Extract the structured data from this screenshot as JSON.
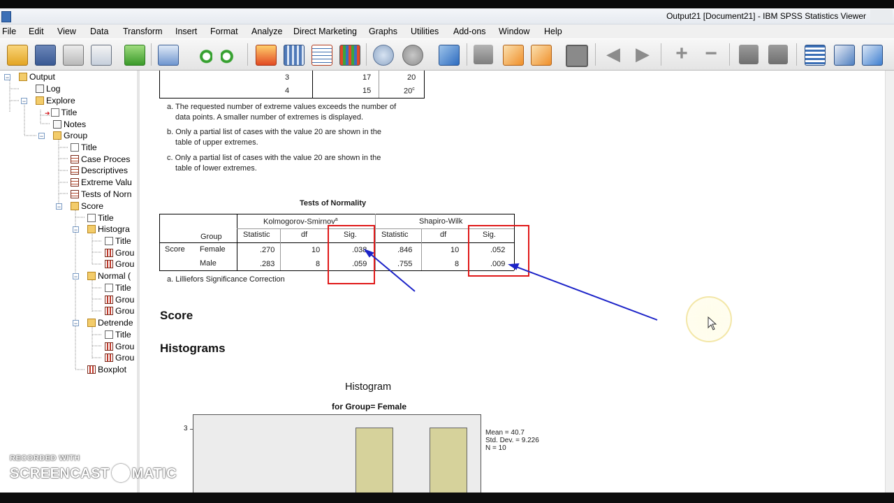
{
  "window": {
    "title": "Output21 [Document21] - IBM SPSS Statistics Viewer"
  },
  "menu": [
    "File",
    "Edit",
    "View",
    "Data",
    "Transform",
    "Insert",
    "Format",
    "Analyze",
    "Direct Marketing",
    "Graphs",
    "Utilities",
    "Add-ons",
    "Window",
    "Help"
  ],
  "toolbar_icons": [
    "open-icon",
    "save-icon",
    "print-icon",
    "print-preview-icon",
    "export-icon",
    "recall-dialog-icon",
    "undo-icon",
    "redo-icon",
    "goto-case-icon",
    "goto-variable-icon",
    "insert-case-icon",
    "variables-icon",
    "use-sets-icon",
    "show-all-variables-icon",
    "designate-window-icon",
    "promote-icon",
    "insert-heading-icon",
    "insert-title-icon",
    "insert-text-icon",
    "insert-output-icon",
    "back-icon",
    "forward-icon",
    "expand-icon",
    "collapse-icon",
    "show-icon",
    "hide-icon",
    "select-output-icon",
    "outline-icon",
    "export-output-icon"
  ],
  "tree": {
    "output": "Output",
    "log": "Log",
    "explore": "Explore",
    "title1": "Title",
    "notes": "Notes",
    "group": "Group",
    "g_title": "Title",
    "case_proc": "Case Proces",
    "descriptives": "Descriptives",
    "extreme": "Extreme Valu",
    "tests_norm": "Tests of Norn",
    "score": "Score",
    "s_title": "Title",
    "histogram": "Histogra",
    "h_title": "Title",
    "h_grou1": "Grou",
    "h_grou2": "Grou",
    "normal": "Normal (",
    "n_title": "Title",
    "n_grou1": "Grou",
    "n_grou2": "Grou",
    "detrended": "Detrende",
    "d_title": "Title",
    "d_grou1": "Grou",
    "d_grou2": "Grou",
    "boxplot": "Boxplot"
  },
  "extreme_table": {
    "rows": [
      {
        "case": "3",
        "number": "17",
        "value": "20"
      },
      {
        "case": "4",
        "number": "15",
        "value": "20",
        "sup": "c"
      }
    ],
    "footnotes": {
      "a1": "a. The requested number of extreme values exceeds the number of",
      "a2": "data points. A smaller number of extremes is displayed.",
      "b1": "b. Only a partial list of cases with the value 20 are shown in the",
      "b2": "table of upper extremes.",
      "c1": "c. Only a partial list of cases with the value 20 are shown in the",
      "c2": "table of lower extremes."
    }
  },
  "normality": {
    "title": "Tests of Normality",
    "ks_header": "Kolmogorov-Smirnov",
    "ks_sup": "a",
    "sw_header": "Shapiro-Wilk",
    "group_header": "Group",
    "col_statistic": "Statistic",
    "col_df": "df",
    "col_sig": "Sig.",
    "row_label": "Score",
    "rows": [
      {
        "group": "Female",
        "ks_stat": ".270",
        "ks_df": "10",
        "ks_sig": ".038",
        "sw_stat": ".846",
        "sw_df": "10",
        "sw_sig": ".052"
      },
      {
        "group": "Male",
        "ks_stat": ".283",
        "ks_df": "8",
        "ks_sig": ".059",
        "sw_stat": ".755",
        "sw_df": "8",
        "sw_sig": ".009"
      }
    ],
    "footnote": "a. Lilliefors Significance Correction"
  },
  "headings": {
    "score": "Score",
    "histograms": "Histograms"
  },
  "histogram": {
    "title": "Histogram",
    "subtitle": "for Group= Female",
    "stats": {
      "mean": "Mean = 40.7",
      "sd": "Std. Dev. = 9.226",
      "n": "N = 10"
    },
    "ytick": "3"
  },
  "chart_data": {
    "type": "bar",
    "title": "Histogram",
    "subtitle": "for Group= Female",
    "yticks": [
      3
    ],
    "visible_bars_frequency": [
      3,
      3
    ],
    "bar_color": "#d6d29b"
  },
  "watermark": {
    "line1": "RECORDED WITH",
    "line2a": "SCREENCAST",
    "line2b": "MATIC"
  },
  "colors": {
    "annotation_red": "#e01818",
    "annotation_blue": "#1c23c8"
  }
}
